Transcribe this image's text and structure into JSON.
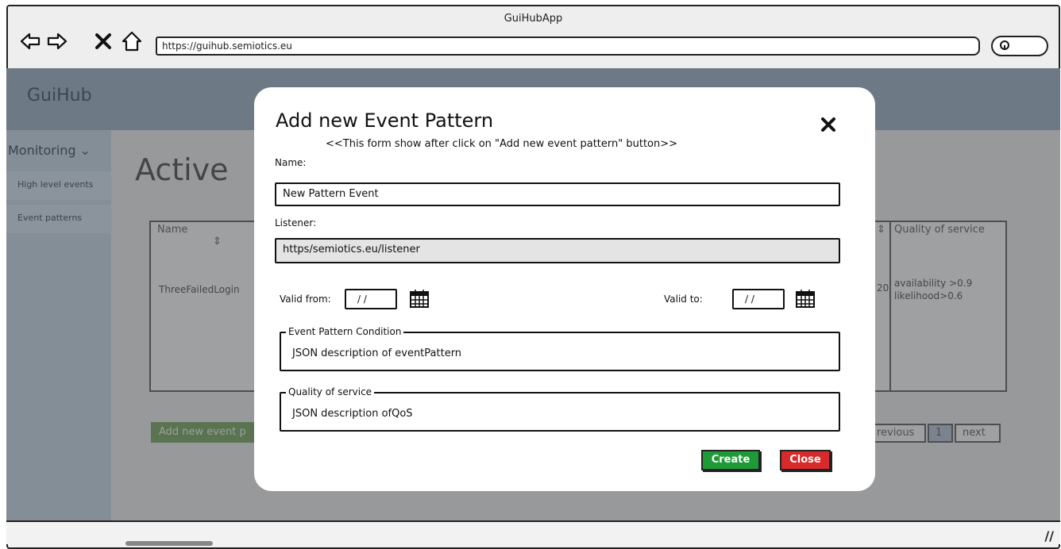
{
  "window": {
    "title": "GuiHubApp"
  },
  "browser": {
    "url": "https://guihub.semiotics.eu",
    "icons": [
      "back-arrow-icon",
      "forward-arrow-icon",
      "stop-x-icon",
      "home-icon",
      "search-icon"
    ]
  },
  "app": {
    "brand": "GuiHub",
    "sidebar": {
      "section": "Monitoring",
      "items": [
        {
          "label": "High level events"
        },
        {
          "label": "Event patterns"
        }
      ]
    },
    "page_title": "Active",
    "table": {
      "header_name": "Name",
      "header_qos": "Quality of service",
      "row_name": "ThreeFailedLogin",
      "row_partial": "20",
      "row_qos_line1": "availability >0.9",
      "row_qos_line2": "likelihood>0.6"
    },
    "add_button": "Add new event p",
    "pager": {
      "previous": "revious",
      "page": "1",
      "next": "next"
    }
  },
  "modal": {
    "title": "Add new Event Pattern",
    "note": "<<This form show after click on \"Add new event pattern\" button>>",
    "name_label": "Name:",
    "name_value": "New Pattern Event",
    "listener_label": "Listener:",
    "listener_value": "https/semiotics.eu/listener",
    "valid_from_label": "Valid from:",
    "valid_from_value": "/ /",
    "valid_to_label": "Valid to:",
    "valid_to_value": "/ /",
    "condition_legend": "Event Pattern Condition",
    "condition_value": "JSON description of eventPattern",
    "qos_legend": "Quality of service",
    "qos_value": "JSON description ofQoS",
    "create_label": "Create",
    "close_label": "Close"
  },
  "colors": {
    "create": "#1e9a36",
    "close": "#d82a2a",
    "header": "#8da4b8"
  }
}
